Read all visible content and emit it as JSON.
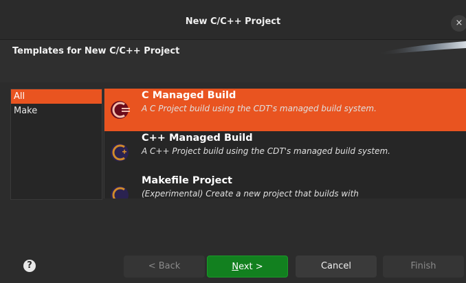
{
  "window": {
    "title": "New C/C++ Project",
    "close_glyph": "×",
    "header": "Templates for New C/C++ Project"
  },
  "categories": [
    {
      "label": "All",
      "selected": true
    },
    {
      "label": "Make",
      "selected": false
    }
  ],
  "templates": [
    {
      "title": "C Managed Build",
      "description": "A C Project build using the CDT's managed build system.",
      "selected": true,
      "icon": "cdt-c-icon"
    },
    {
      "title": "C++ Managed Build",
      "description": "A C++ Project build using the CDT's managed build system.",
      "selected": false,
      "icon": "cdt-cpp-icon"
    },
    {
      "title": "Makefile Project",
      "description": "(Experimental) Create a new project that builds with",
      "selected": false,
      "icon": "cdt-make-icon"
    }
  ],
  "buttons": {
    "help_glyph": "?",
    "back": "< Back",
    "next_mnemonic": "N",
    "next_rest": "ext >",
    "cancel": "Cancel",
    "finish": "Finish"
  },
  "colors": {
    "accent": "#e95420",
    "primary_button": "#12801f"
  }
}
